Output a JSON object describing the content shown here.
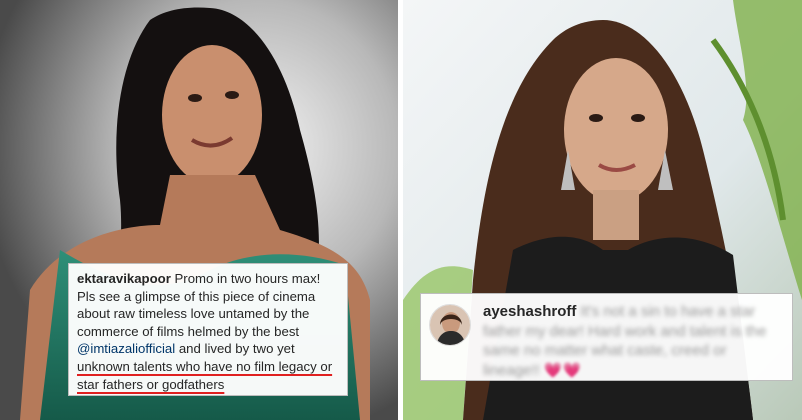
{
  "left_post": {
    "username": "ektaravikapoor",
    "text_before_mention": "Promo in two hours max! Pls see a glimpse of this piece of cinema about raw timeless love untamed by the commerce of films helmed by the best",
    "mention": "@imtiazaliofficial",
    "text_after_mention": "and lived by two yet",
    "underlined_text": "unknown talents who have no film legacy or star fathers or godfathers",
    "underline_color": "#e02020"
  },
  "right_post": {
    "username": "ayeshashroff",
    "blurred_text": "It's not a sin to have a star father my dear! Hard work and talent is the same no matter what caste, creed or lineage!!",
    "hearts": "💗💗"
  }
}
